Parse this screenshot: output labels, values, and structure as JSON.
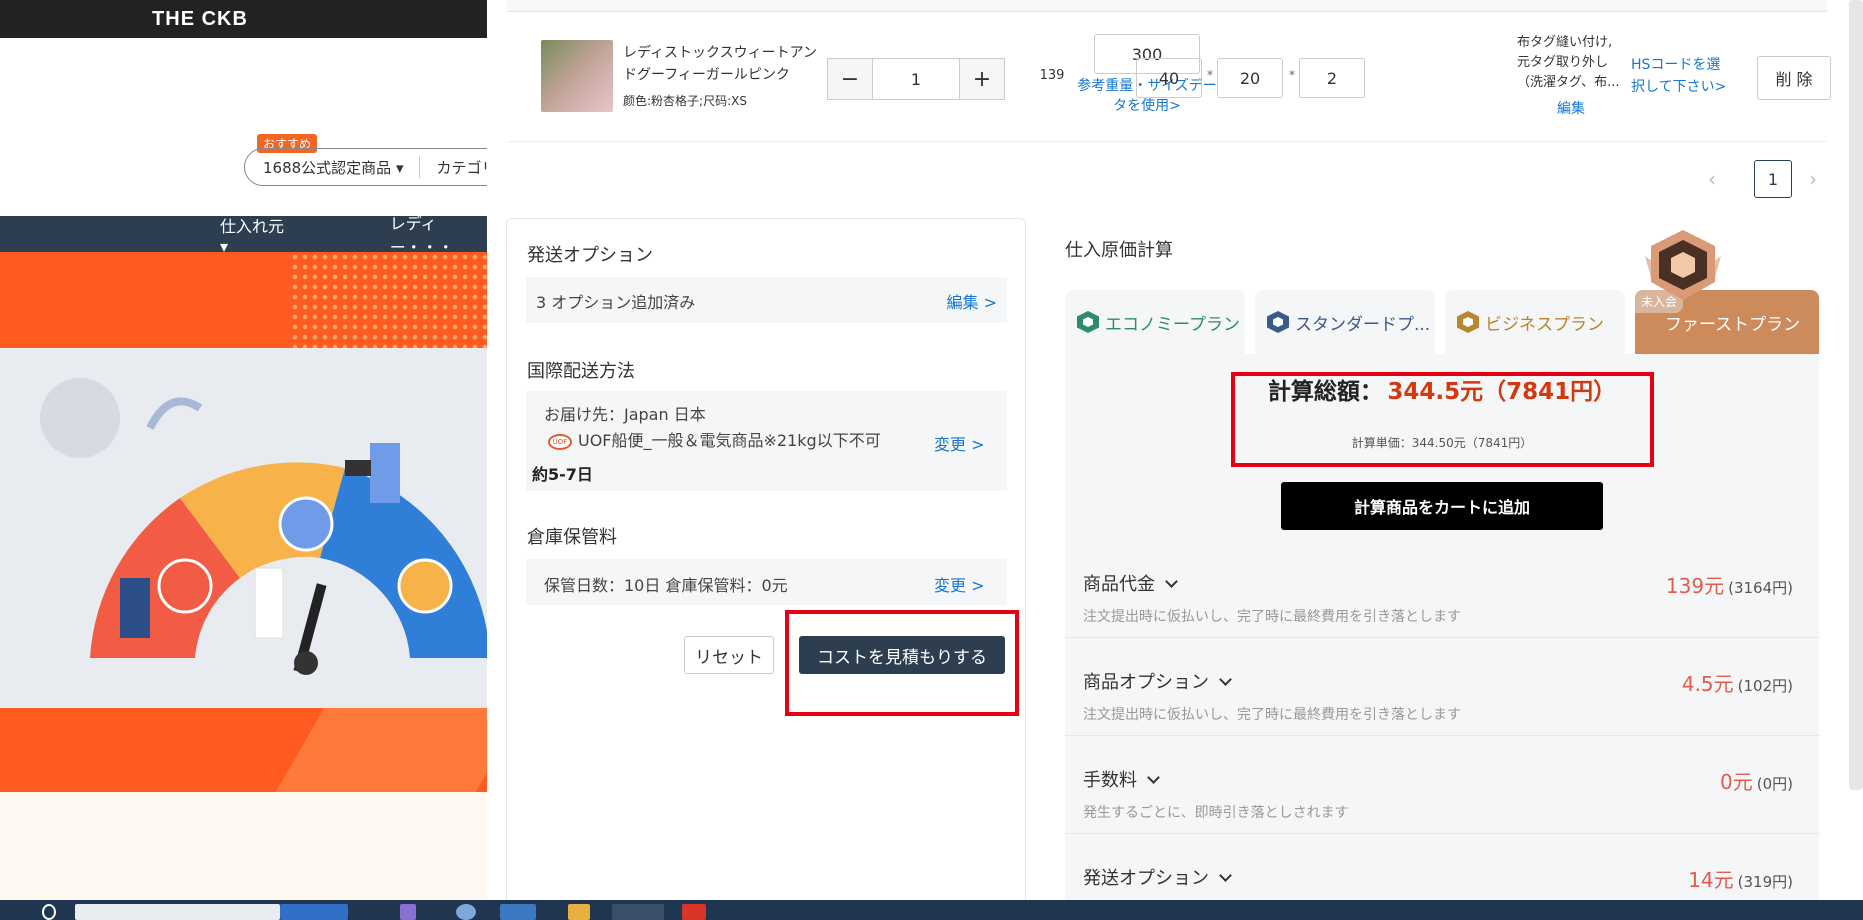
{
  "site": {
    "logo": "THE CKB",
    "badge": "おすすめ",
    "search_select": "1688公式認定商品 ▾",
    "search_category": "カテゴリ",
    "nav": [
      "仕入れ元 ▾",
      "レディー・・・"
    ]
  },
  "product": {
    "name": "レディストックスウィートアンドグーフィーガールピンク",
    "variant": "颜色:粉杏格子;尺码:XS",
    "quantity": "1",
    "minus": "−",
    "plus": "+",
    "price": "139",
    "weight": "300",
    "weight_link": "参考重量・サイズデータを使用>",
    "dims": [
      "40",
      "20",
      "2"
    ],
    "dim_sep": "*",
    "tag_text": "布タグ縫い付け, 元タグ取り外し（洗濯タグ、布...",
    "tag_edit": "編集",
    "hs_link": "HSコードを選択して下さい>",
    "delete": "削 除"
  },
  "pager": {
    "prev": "‹",
    "page": "1",
    "next": "›"
  },
  "options": {
    "ship_title": "発送オプション",
    "ship_value": "3 オプション追加済み",
    "ship_edit": "編集 >",
    "intl_title": "国際配送方法",
    "dest": "お届け先：Japan 日本",
    "uof_icon": "UOF",
    "method": "UOF船便_一般＆電気商品※21kg以下不可",
    "method_days": "約5-7日",
    "intl_change": "変更 >",
    "storage_title": "倉庫保管料",
    "storage_value": "保管日数：10日  倉庫保管料：0元",
    "storage_change": "変更 >",
    "reset": "リセット",
    "estimate": "コストを見積もりする"
  },
  "calc": {
    "title": "仕入原価計算",
    "tabs": [
      {
        "label": "エコノミープラン",
        "color": "#2e8b6e"
      },
      {
        "label": "スタンダードプ...",
        "color": "#3a5a8c"
      },
      {
        "label": "ビジネスプラン",
        "color": "#b8862f"
      },
      {
        "label": "ファーストプラン",
        "tag": "未入会"
      }
    ],
    "total_label": "計算総額：",
    "total_value": "344.5元（7841円）",
    "unit_price": "計算単価：344.50元（7841円）",
    "add_cart": "計算商品をカートに追加",
    "rows": [
      {
        "name": "商品代金",
        "desc": "注文提出時に仮払いし、完了時に最終費用を引き落とします",
        "value": "139元",
        "yen": "(3164円)"
      },
      {
        "name": "商品オプション",
        "desc": "注文提出時に仮払いし、完了時に最終費用を引き落とします",
        "value": "4.5元",
        "yen": "(102円)"
      },
      {
        "name": "手数料",
        "desc": "発生するごとに、即時引き落としされます",
        "value": "0元",
        "yen": "(0円)"
      },
      {
        "name": "発送オプション",
        "desc": "",
        "value": "14元",
        "yen": "(319円)"
      }
    ]
  },
  "colors": {
    "accent_red": "#e60012",
    "navy": "#2d3e50",
    "orange": "#ff5a1f",
    "plan_active": "#cd8b5c"
  }
}
